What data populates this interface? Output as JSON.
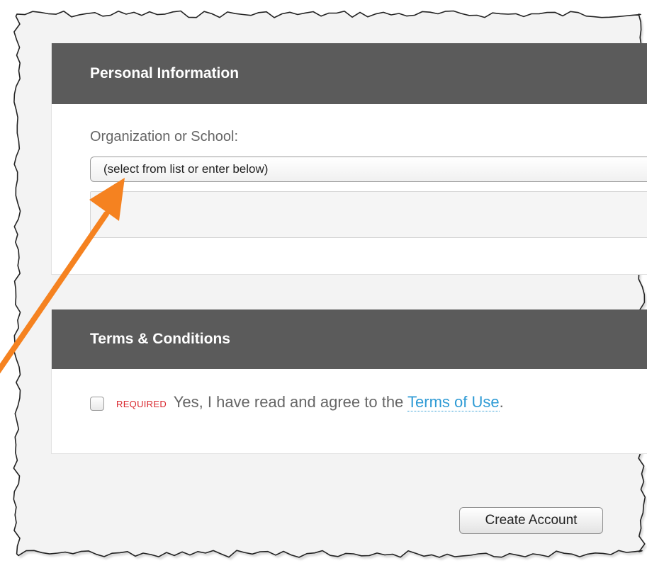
{
  "personal_section": {
    "title": "Personal Information",
    "organization_label": "Organization or School:",
    "organization_select_value": "(select from list or enter below)",
    "organization_input_value": ""
  },
  "terms_section": {
    "title": "Terms & Conditions",
    "required_tag": "REQUIRED",
    "agree_text": "Yes, I have read and agree to the ",
    "terms_link": "Terms of Use",
    "agree_suffix": ".",
    "checked": false
  },
  "actions": {
    "create_account_label": "Create Account"
  },
  "annotation": {
    "arrow_color": "#f58220",
    "arrow_icon": "annotation-arrow-icon"
  },
  "colors": {
    "section_header_bg": "#5b5b5b",
    "link": "#2f9bd5",
    "required": "#d9262c"
  }
}
